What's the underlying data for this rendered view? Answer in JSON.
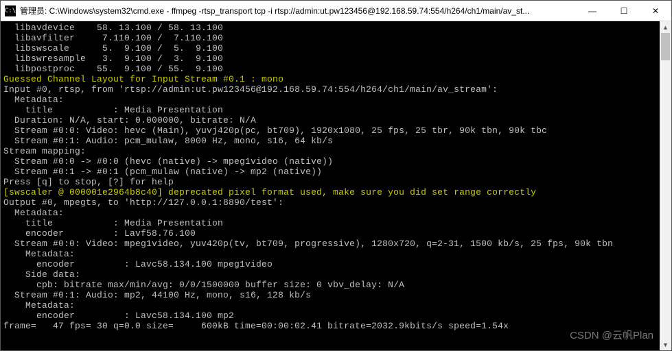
{
  "titlebar": {
    "icon_label": "C:\\",
    "text": "管理员: C:\\Windows\\system32\\cmd.exe - ffmpeg  -rtsp_transport tcp -i rtsp://admin:ut.pw123456@192.168.59.74:554/h264/ch1/main/av_st..."
  },
  "win_controls": {
    "min": "—",
    "max": "☐",
    "close": "✕"
  },
  "scroll": {
    "up": "▲",
    "down": "▼"
  },
  "lines": [
    {
      "t": "  libavdevice    58. 13.100 / 58. 13.100",
      "c": "n"
    },
    {
      "t": "  libavfilter     7.110.100 /  7.110.100",
      "c": "n"
    },
    {
      "t": "  libswscale      5.  9.100 /  5.  9.100",
      "c": "n"
    },
    {
      "t": "  libswresample   3.  9.100 /  3.  9.100",
      "c": "n"
    },
    {
      "t": "  libpostproc    55.  9.100 / 55.  9.100",
      "c": "n"
    },
    {
      "t": "Guessed Channel Layout for Input Stream #0.1 : mono",
      "c": "y"
    },
    {
      "t": "Input #0, rtsp, from 'rtsp://admin:ut.pw123456@192.168.59.74:554/h264/ch1/main/av_stream':",
      "c": "n"
    },
    {
      "t": "  Metadata:",
      "c": "n"
    },
    {
      "t": "    title           : Media Presentation",
      "c": "n"
    },
    {
      "t": "  Duration: N/A, start: 0.000000, bitrate: N/A",
      "c": "n"
    },
    {
      "t": "  Stream #0:0: Video: hevc (Main), yuvj420p(pc, bt709), 1920x1080, 25 fps, 25 tbr, 90k tbn, 90k tbc",
      "c": "n"
    },
    {
      "t": "  Stream #0:1: Audio: pcm_mulaw, 8000 Hz, mono, s16, 64 kb/s",
      "c": "n"
    },
    {
      "t": "Stream mapping:",
      "c": "n"
    },
    {
      "t": "  Stream #0:0 -> #0:0 (hevc (native) -> mpeg1video (native))",
      "c": "n"
    },
    {
      "t": "  Stream #0:1 -> #0:1 (pcm_mulaw (native) -> mp2 (native))",
      "c": "n"
    },
    {
      "t": "Press [q] to stop, [?] for help",
      "c": "n"
    },
    {
      "t": "[swscaler @ 000001e2964b8c40] deprecated pixel format used, make sure you did set range correctly",
      "c": "y"
    },
    {
      "t": "Output #0, mpegts, to 'http://127.0.0.1:8890/test':",
      "c": "n"
    },
    {
      "t": "  Metadata:",
      "c": "n"
    },
    {
      "t": "    title           : Media Presentation",
      "c": "n"
    },
    {
      "t": "    encoder         : Lavf58.76.100",
      "c": "n"
    },
    {
      "t": "  Stream #0:0: Video: mpeg1video, yuv420p(tv, bt709, progressive), 1280x720, q=2-31, 1500 kb/s, 25 fps, 90k tbn",
      "c": "n"
    },
    {
      "t": "    Metadata:",
      "c": "n"
    },
    {
      "t": "      encoder         : Lavc58.134.100 mpeg1video",
      "c": "n"
    },
    {
      "t": "    Side data:",
      "c": "n"
    },
    {
      "t": "      cpb: bitrate max/min/avg: 0/0/1500000 buffer size: 0 vbv_delay: N/A",
      "c": "n"
    },
    {
      "t": "  Stream #0:1: Audio: mp2, 44100 Hz, mono, s16, 128 kb/s",
      "c": "n"
    },
    {
      "t": "    Metadata:",
      "c": "n"
    },
    {
      "t": "      encoder         : Lavc58.134.100 mp2",
      "c": "n"
    },
    {
      "t": "frame=   47 fps= 30 q=0.0 size=     600kB time=00:00:02.41 bitrate=2032.9kbits/s speed=1.54x",
      "c": "n"
    }
  ],
  "watermark": "CSDN @云帆Plan"
}
